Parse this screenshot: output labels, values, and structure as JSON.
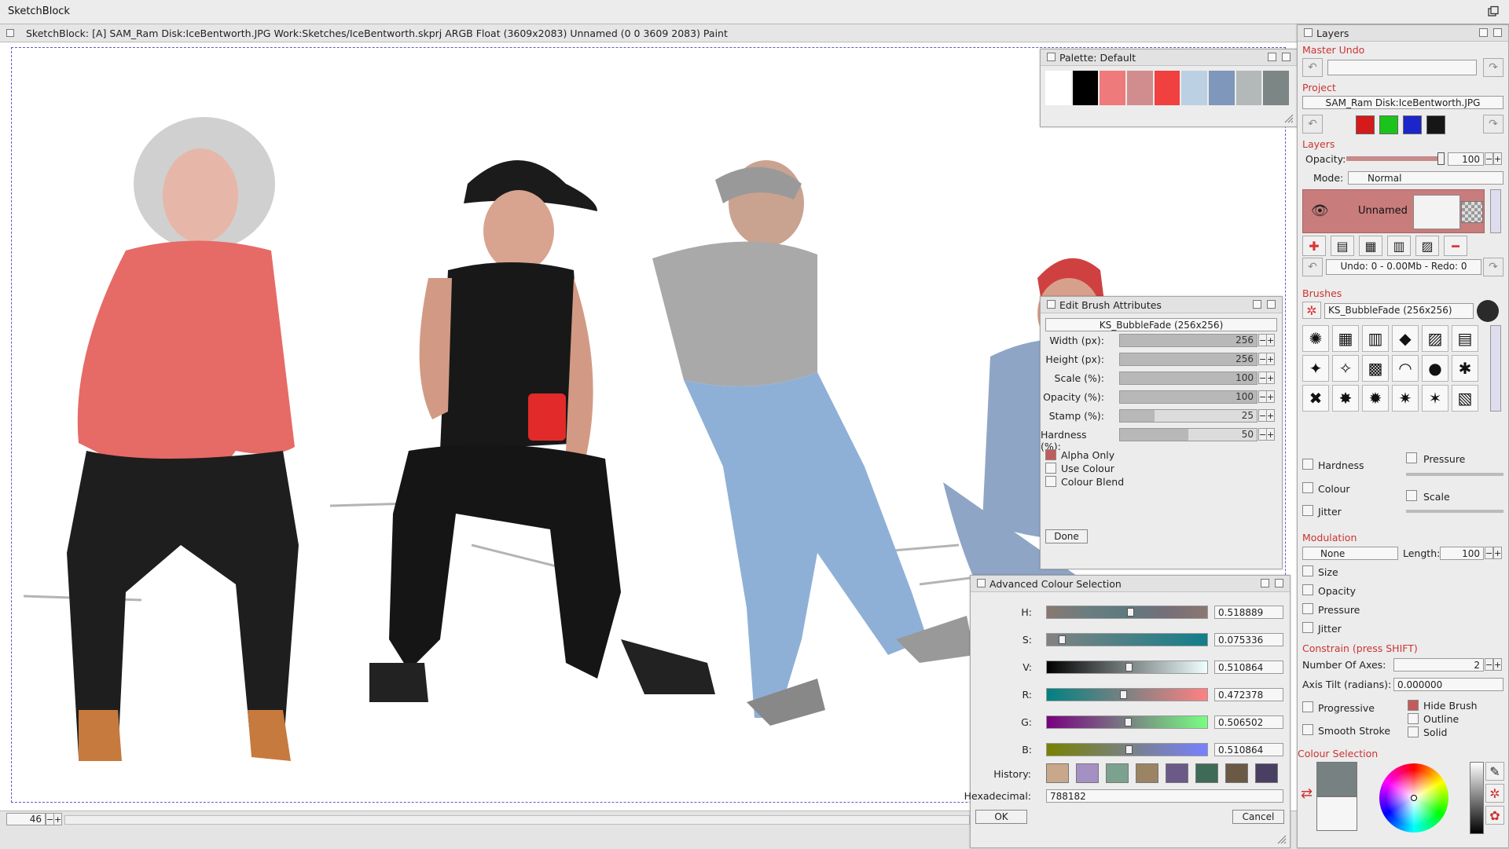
{
  "window": {
    "title": "SketchBlock"
  },
  "document": {
    "title": "SketchBlock:  [A]  SAM_Ram Disk:IceBentworth.JPG  Work:Sketches/IceBentworth.skprj ARGB Float (3609x2083) Unnamed (0 0 3609 2083) Paint"
  },
  "statusbar": {
    "zoom": "46"
  },
  "palette": {
    "title": "Palette: Default",
    "colors": [
      "#ffffff",
      "#000000",
      "#ef7a7c",
      "#d18d8d",
      "#f04040",
      "#bcd0e4",
      "#7f97bb",
      "#b3b8b8",
      "#7c8684"
    ]
  },
  "brush_editor": {
    "title": "Edit Brush Attributes",
    "brush_name": "KS_BubbleFade (256x256)",
    "rows": [
      {
        "label": "Width (px):",
        "value": "256",
        "fill": 1.0
      },
      {
        "label": "Height (px):",
        "value": "256",
        "fill": 1.0
      },
      {
        "label": "Scale (%):",
        "value": "100",
        "fill": 1.0
      },
      {
        "label": "Opacity (%):",
        "value": "100",
        "fill": 1.0
      },
      {
        "label": "Stamp (%):",
        "value": "25",
        "fill": 0.25
      },
      {
        "label": "Hardness (%):",
        "value": "50",
        "fill": 0.5
      }
    ],
    "alpha_only": "Alpha Only",
    "use_colour": "Use Colour",
    "colour_blend": "Colour Blend",
    "done": "Done"
  },
  "colour_selection": {
    "title": "Advanced Colour Selection",
    "channels": [
      {
        "label": "H:",
        "value": "0.518889",
        "level": 0.518889,
        "gradient": "linear-gradient(90deg,#8a7770,#6b7d80,#5d7a7e,#766e79,#8a7770)"
      },
      {
        "label": "S:",
        "value": "0.075336",
        "level": 0.075336,
        "gradient": "linear-gradient(90deg,#828282,#127e8a)"
      },
      {
        "label": "V:",
        "value": "0.510864",
        "level": 0.510864,
        "gradient": "linear-gradient(90deg,#000000,#f0ffff)"
      },
      {
        "label": "R:",
        "value": "0.472378",
        "level": 0.472378,
        "gradient": "linear-gradient(90deg,#008182,#ff8182)"
      },
      {
        "label": "G:",
        "value": "0.506502",
        "level": 0.506502,
        "gradient": "linear-gradient(90deg,#780082,#78ff82)"
      },
      {
        "label": "B:",
        "value": "0.510864",
        "level": 0.510864,
        "gradient": "linear-gradient(90deg,#788100,#7881ff)"
      }
    ],
    "history_label": "History:",
    "history": [
      "#c8a78b",
      "#a590c4",
      "#7ba28f",
      "#9b8464",
      "#6b5a88",
      "#3e6a58",
      "#6a5a45",
      "#4a3f62"
    ],
    "hex_label": "Hexadecimal:",
    "hex_value": "788182",
    "ok": "OK",
    "cancel": "Cancel"
  },
  "layers_panel": {
    "title": "Layers",
    "master_undo": "Master Undo",
    "project": "Project",
    "project_file": "SAM_Ram Disk:IceBentworth.JPG",
    "project_colors": [
      "#d41a1a",
      "#1bc41b",
      "#1b25c9",
      "#161616"
    ],
    "layers_label": "Layers",
    "opacity_label": "Opacity:",
    "opacity_value": "100",
    "opacity_level": 1.0,
    "mode_label": "Mode:",
    "mode_value": "Normal",
    "layer_name": "Unnamed",
    "undo_info": "Undo: 0 - 0.00Mb - Redo: 0",
    "brushes_label": "Brushes",
    "brush_selected": "KS_BubbleFade (256x256)",
    "brush_glyphs": [
      "✺",
      "▦",
      "▥",
      "◆",
      "▨",
      "▤",
      "✦",
      "✧",
      "▩",
      "◠",
      "●",
      "✱",
      "✖",
      "✸",
      "✹",
      "✷",
      "✶",
      "▧"
    ],
    "opt_hardness": "Hardness",
    "opt_colour": "Colour",
    "opt_jitter": "Jitter",
    "opt_pressure": "Pressure",
    "opt_scale": "Scale",
    "modulation_label": "Modulation",
    "mod_value": "None",
    "length_label": "Length:",
    "length_value": "100",
    "mod_size": "Size",
    "mod_opacity": "Opacity",
    "mod_pressure": "Pressure",
    "mod_jitter": "Jitter",
    "constrain_label": "Constrain (press SHIFT)",
    "axes_label": "Number Of Axes:",
    "axes_value": "2",
    "tilt_label": "Axis Tilt (radians):",
    "tilt_value": "0.000000",
    "progressive": "Progressive",
    "smooth_stroke": "Smooth Stroke",
    "hide_brush": "Hide Brush",
    "outline": "Outline",
    "solid": "Solid",
    "colour_selection_label": "Colour Selection"
  }
}
